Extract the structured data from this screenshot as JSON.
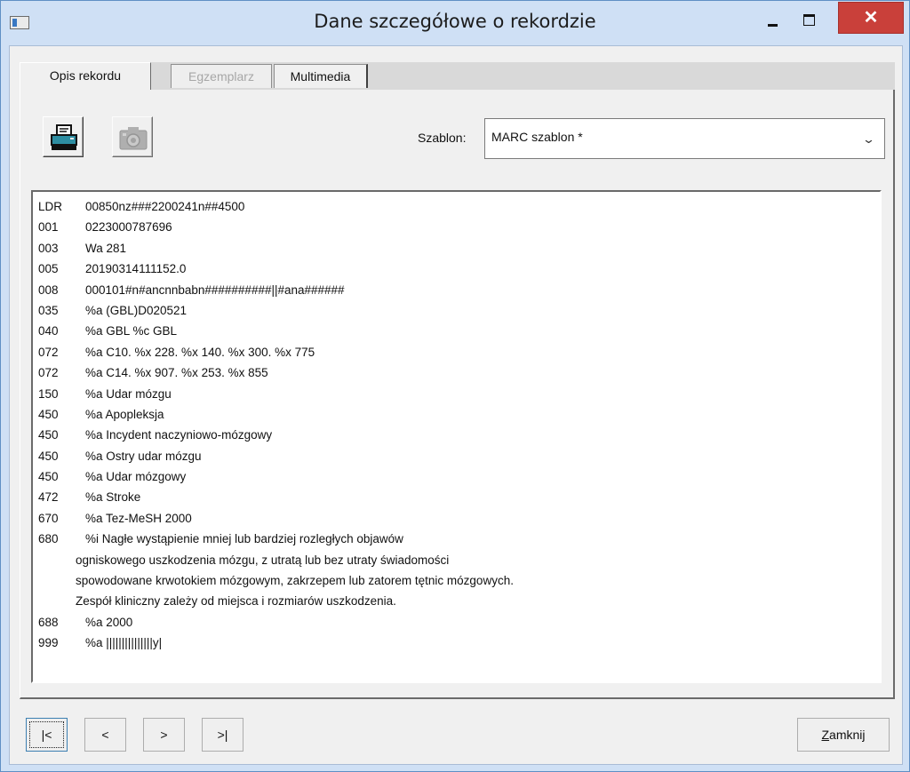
{
  "window": {
    "title": "Dane szczegółowe o rekordzie",
    "close_glyph": "✕"
  },
  "tabs": [
    {
      "label": "Opis rekordu",
      "state": "active"
    },
    {
      "label": "Egzemplarz",
      "state": "disabled"
    },
    {
      "label": "Multimedia",
      "state": "normal"
    }
  ],
  "toolbar": {
    "print_icon": "printer-icon",
    "camera_icon": "camera-icon"
  },
  "szablon": {
    "label": "Szablon:",
    "value": "MARC szablon *"
  },
  "record": [
    {
      "tag": "LDR",
      "value": "00850nz###2200241n##4500"
    },
    {
      "tag": "001",
      "value": "0223000787696"
    },
    {
      "tag": "003",
      "value": "Wa 281"
    },
    {
      "tag": "005",
      "value": "20190314111152.0"
    },
    {
      "tag": "008",
      "value": "000101#n#ancnnbabn##########||#ana######"
    },
    {
      "tag": "035",
      "value": "%a (GBL)D020521"
    },
    {
      "tag": "040",
      "value": "%a GBL %c GBL"
    },
    {
      "tag": "072",
      "value": "%a C10. %x 228. %x 140. %x 300. %x 775"
    },
    {
      "tag": "072",
      "value": "%a C14. %x 907. %x 253. %x 855"
    },
    {
      "tag": "150",
      "value": "%a Udar mózgu"
    },
    {
      "tag": "450",
      "value": "%a Apopleksja"
    },
    {
      "tag": "450",
      "value": "%a Incydent naczyniowo-mózgowy"
    },
    {
      "tag": "450",
      "value": "%a Ostry udar mózgu"
    },
    {
      "tag": "450",
      "value": "%a Udar mózgowy"
    },
    {
      "tag": "472",
      "value": "%a Stroke"
    },
    {
      "tag": "670",
      "value": "%a Tez-MeSH 2000"
    },
    {
      "tag": "680",
      "value": "%i Nagłe wystąpienie mniej lub bardziej rozległych objawów"
    },
    {
      "tag": "",
      "value": "ogniskowego uszkodzenia mózgu, z utratą lub bez utraty świadomości"
    },
    {
      "tag": "",
      "value": "spowodowane krwotokiem mózgowym, zakrzepem lub zatorem tętnic mózgowych."
    },
    {
      "tag": "",
      "value": "Zespół kliniczny zależy od miejsca i rozmiarów uszkodzenia."
    },
    {
      "tag": "688",
      "value": "%a 2000"
    },
    {
      "tag": "999",
      "value": "%a |||||||||||||||y|"
    }
  ],
  "nav": {
    "first": "|<",
    "prev": "<",
    "next": ">",
    "last": ">|"
  },
  "close_button": {
    "label": "Zamknij"
  }
}
